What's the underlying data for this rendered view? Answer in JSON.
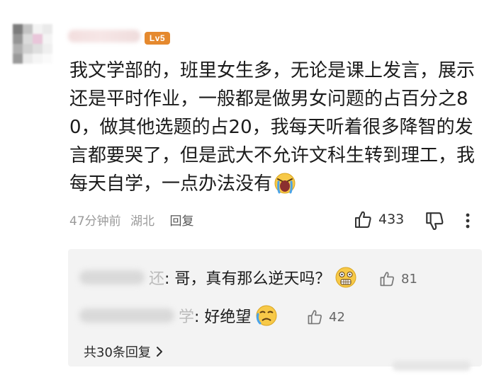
{
  "comment": {
    "level_badge": "Lv5",
    "text": "我文学部的，班里女生多，无论是课上发言，展示还是平时作业，一般都是做男女问题的占百分之80，做其他选题的占20，我每天听着很多降智的发言都要哭了，但是武大不允许文科生转到理工，我每天自学，一点办法没有",
    "emoji_icon": "crying-face-icon",
    "time": "47分钟前",
    "location": "湖北",
    "reply_label": "回复",
    "like_count": "433"
  },
  "replies": [
    {
      "name_suffix": "还",
      "text": ": 哥，真有那么逆天吗？",
      "emoji_icon": "shocked-face-icon",
      "like_count": "81"
    },
    {
      "name_suffix": "学",
      "text": ": 好绝望",
      "emoji_icon": "crying-face-icon",
      "like_count": "42"
    }
  ],
  "total_replies_label": "共30条回复",
  "colors": {
    "level_badge": "#e5892e",
    "reply_bg": "#f3f3f3",
    "meta_gray": "#9a9a9a"
  }
}
